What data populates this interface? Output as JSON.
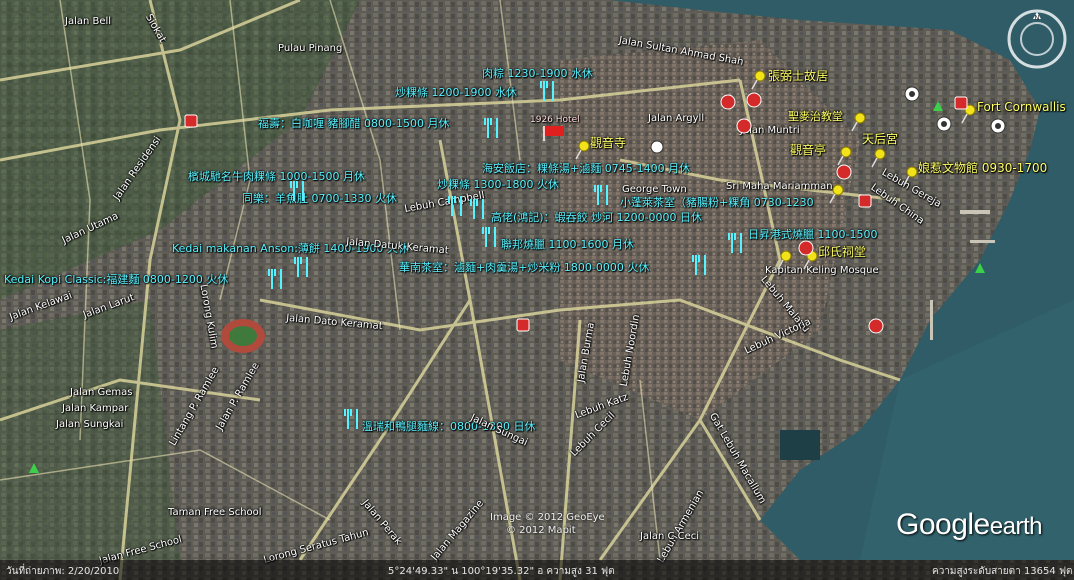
{
  "map": {
    "colors": {
      "sea": "#2f5c66",
      "land": "#5b5a52",
      "road": "#d8d29a",
      "cyan_label": "#57f2ff",
      "yellow_label": "#ffff66"
    },
    "food_labels": [
      "肉粽 1230-1900 水休",
      "炒粿條 1200-1900 水休",
      "福壽：白咖喱 豬腳醋 0800-1500 月休",
      "檳城馳名牛肉粿條 1000-1500 月休",
      "同樂：羊魚肚 0700-1330 火休",
      "Kedai makanan Anson:薄餅 1400-1900 火休",
      "Kedai Kopi Classic:福建麵 0800-1200 火休",
      "海安飯店：粿條湯+滷麵 0745-1400 月休",
      "炒粿條 1300-1800 火休",
      "小蓬萊茶室（豬腸粉+粿角 0730-1230",
      "高佬(鴻記)：蝦吞餃 炒河 1200-0000 日休",
      "聯邦燒臘 1100-1600 月休",
      "華南茶室：滷麵+肉羹湯+炒米粉 1800-0000 火休",
      "日昇港式燒臘 1100-1500",
      "溫瑞和鴨腿麵線：0800-1300 日休"
    ],
    "landmark_labels": [
      "觀音寺",
      "張弼士故居",
      "聖麥治教堂",
      "天后宮",
      "觀音亭",
      "娘惹文物館 0930-1700",
      "邱氏祠堂",
      "Fort Cornwallis",
      "Sri Maha Mariamman",
      "Kapitan Keling Mosque"
    ],
    "place_labels": [
      "Pulau Pinang",
      "George Town",
      "Taman Free School"
    ],
    "hotel_label": "1926 Hotel",
    "street_labels": [
      "Jalan Bell",
      "Siokat",
      "Jalan Sultan Ahmad Shah",
      "Jalan Residensi",
      "Jalan Utama",
      "Jalan Larut",
      "Jalan Argyll",
      "Jalan Muntri",
      "Lebuh Gereja",
      "Lebuh China",
      "Lebuh Malayu",
      "Lebuh Victoria",
      "Jalan Dato Keramat",
      "Jalan Kelawai",
      "Lorong Kulim",
      "Jalan P. Ramlee",
      "Jalan Gemas",
      "Jalan Kampar",
      "Jalan Sungkai",
      "Lintang P. Ramlee",
      "Jalan Burma",
      "Lebuh Noordin",
      "Lebuh Katz",
      "Lebuh Cecil",
      "Gat Lebuh Macallum",
      "Lebuh Armenian",
      "Jalan Sungai",
      "Jalan Perak",
      "Jalan Free School",
      "Lorong Seratus Tahun",
      "Jalan Magazine",
      "Jalan Datuk Keramat",
      "Jalan C Ceci",
      "Lebuh Campbell"
    ]
  },
  "imagery": {
    "copyright_1": "Image © 2012 GeoEye",
    "copyright_2": "© 2012 Mapit"
  },
  "status_bar": {
    "date": "วันที่ถ่ายภาพ: 2/20/2010",
    "coordinates": "5°24'49.33\" น   100°19'35.32\" อ  ความสูง   31 ฟุต",
    "eye_altitude": "ความสูงระดับสายตา    13654 ฟุต"
  },
  "brand": {
    "word1": "Google",
    "word2": "earth"
  }
}
